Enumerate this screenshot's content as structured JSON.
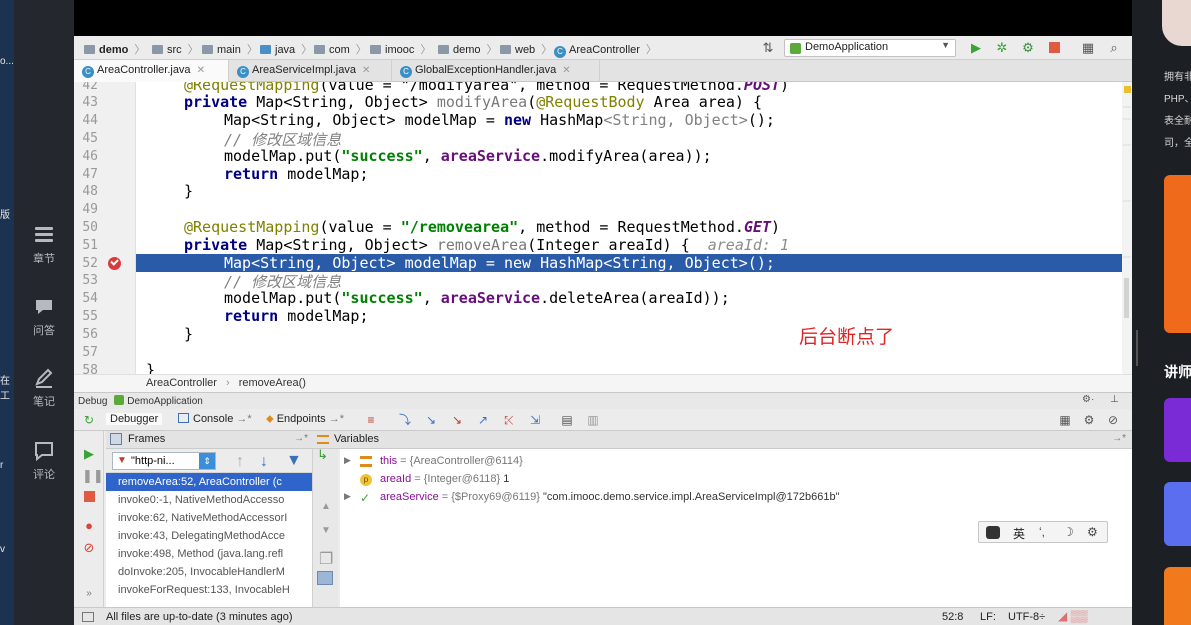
{
  "course_left": {
    "edge_fragments": [
      "o...",
      "版",
      "在工",
      "r",
      "v"
    ],
    "items": [
      {
        "label": "章节",
        "icon": "list-icon"
      },
      {
        "label": "问答",
        "icon": "chat-bubble-icon"
      },
      {
        "label": "笔记",
        "icon": "pencil-icon"
      },
      {
        "label": "评论",
        "icon": "comment-icon"
      }
    ]
  },
  "course_right": {
    "lines": [
      "拥有非",
      "PHP、",
      "表全耐",
      "司，全"
    ],
    "section": "讲师"
  },
  "ide": {
    "breadcrumb": [
      "demo",
      "src",
      "main",
      "java",
      "com",
      "imooc",
      "demo",
      "web",
      "AreaController"
    ],
    "run_config": "DemoApplication",
    "tabs": [
      {
        "label": "AreaController.java",
        "active": true
      },
      {
        "label": "AreaServiceImpl.java",
        "active": false
      },
      {
        "label": "GlobalExceptionHandler.java",
        "active": false
      }
    ],
    "editor": {
      "line_numbers": [
        "42",
        "43",
        "44",
        "45",
        "46",
        "47",
        "48",
        "49",
        "50",
        "51",
        "52",
        "53",
        "54",
        "55",
        "56",
        "57",
        "58"
      ],
      "current_line": "52",
      "lines": {
        "l42_a": "@RequestMapping",
        "l42_b": "(value = \"/modifyarea\", method = RequestMethod.",
        "l42_c": "POST",
        "l42_d": ")",
        "l43_kw": "private ",
        "l43_a": "Map<String, Object> ",
        "l43_fn": "modifyArea",
        "l43_b": "(",
        "l43_an": "@RequestBody ",
        "l43_c": "Area area) {",
        "l44_a": "Map<String, Object> modelMap = ",
        "l44_kw": "new ",
        "l44_b": "HashMap",
        "l44_gr": "<String, Object>",
        "l44_c": "();",
        "l45": "// 修改区域信息",
        "l46_a": "modelMap.put(",
        "l46_st": "\"success\"",
        "l46_b": ", ",
        "l46_mt": "areaService",
        "l46_c": ".modifyArea(area));",
        "l47_kw": "return ",
        "l47_a": "modelMap;",
        "l48": "}",
        "l50_an": "@RequestMapping",
        "l50_a": "(value = ",
        "l50_st": "\"/removearea\"",
        "l50_b": ", method = RequestMethod.",
        "l50_mt": "GET",
        "l50_c": ")",
        "l51_kw": "private ",
        "l51_a": "Map<String, Object> ",
        "l51_fn": "removeArea",
        "l51_b": "(Integer areaId) {",
        "l51_hint": "areaId: 1",
        "l52": "Map<String, Object> modelMap = new HashMap<String, Object>();",
        "l53": "// 修改区域信息",
        "l54_a": "modelMap.put(",
        "l54_st": "\"success\"",
        "l54_b": ", ",
        "l54_mt": "areaService",
        "l54_c": ".deleteArea(areaId));",
        "l55_kw": "return ",
        "l55_a": "modelMap;",
        "l56": "}",
        "l58": "}"
      },
      "annotation": "后台断点了"
    },
    "code_breadcrumb": [
      "AreaController",
      "removeArea()"
    ],
    "debug": {
      "title_prefix": "Debug",
      "title": "DemoApplication",
      "tabs": [
        "Debugger",
        "Console",
        "Endpoints"
      ],
      "frames_header": "Frames",
      "variables_header": "Variables",
      "thread": "\"http-ni...",
      "frames": [
        {
          "text": "removeArea:52, AreaController (c",
          "selected": true
        },
        {
          "text": "invoke0:-1, NativeMethodAccesso",
          "selected": false
        },
        {
          "text": "invoke:62, NativeMethodAccessorI",
          "selected": false
        },
        {
          "text": "invoke:43, DelegatingMethodAcce",
          "selected": false
        },
        {
          "text": "invoke:498, Method (java.lang.refl",
          "selected": false
        },
        {
          "text": "doInvoke:205, InvocableHandlerM",
          "selected": false
        },
        {
          "text": "invokeForRequest:133, InvocableH",
          "selected": false
        }
      ],
      "variables": [
        {
          "name": "this",
          "value_type": " = {AreaController@6114}",
          "value_text": "",
          "icon": "field-icon"
        },
        {
          "name": "areaId",
          "value_type": " = {Integer@6118} ",
          "value_text": "1",
          "icon": "parameter-icon"
        },
        {
          "name": "areaService",
          "value_type": " = {$Proxy69@6119} ",
          "value_text": "\"com.imooc.demo.service.impl.AreaServiceImpl@172b661b\"",
          "icon": "watch-icon"
        }
      ]
    },
    "ime": {
      "mode": "英",
      "punct": "ʻ,",
      "moon": "☽"
    },
    "status": {
      "message": "All files are up-to-date (3 minutes ago)",
      "position": "52:8",
      "line_ending": "LF:",
      "encoding": "UTF-8÷"
    }
  }
}
